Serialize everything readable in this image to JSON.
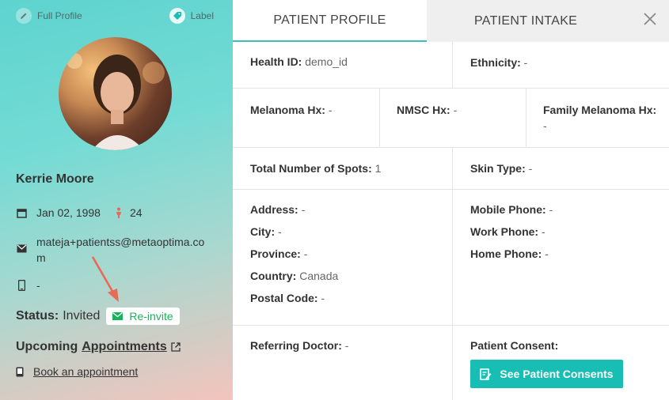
{
  "sidebar": {
    "full_profile_label": "Full Profile",
    "label_label": "Label",
    "name": "Kerrie Moore",
    "dob": "Jan 02, 1998",
    "age": "24",
    "email": "mateja+patientss@metaoptima.com",
    "phone": "-",
    "status_label": "Status:",
    "status_value": "Invited",
    "reinvite_label": "Re-invite",
    "upcoming_label": "Upcoming",
    "appointments_link": "Appointments",
    "book_label": "Book an appointment"
  },
  "tabs": [
    "PATIENT PROFILE",
    "PATIENT INTAKE"
  ],
  "profile": {
    "health_id": {
      "label": "Health ID:",
      "value": "demo_id"
    },
    "ethnicity": {
      "label": "Ethnicity:",
      "value": "-"
    },
    "melanoma_hx": {
      "label": "Melanoma Hx:",
      "value": "-"
    },
    "nmsc_hx": {
      "label": "NMSC Hx:",
      "value": "-"
    },
    "family_melanoma_hx": {
      "label": "Family Melanoma Hx:",
      "value": "-"
    },
    "total_spots": {
      "label": "Total Number of Spots:",
      "value": "1"
    },
    "skin_type": {
      "label": "Skin Type:",
      "value": "-"
    },
    "address": {
      "label": "Address:",
      "value": "-"
    },
    "city": {
      "label": "City:",
      "value": "-"
    },
    "province": {
      "label": "Province:",
      "value": "-"
    },
    "country": {
      "label": "Country:",
      "value": "Canada"
    },
    "postal_code": {
      "label": "Postal Code:",
      "value": "-"
    },
    "mobile_phone": {
      "label": "Mobile Phone:",
      "value": "-"
    },
    "work_phone": {
      "label": "Work Phone:",
      "value": "-"
    },
    "home_phone": {
      "label": "Home Phone:",
      "value": "-"
    },
    "referring_doctor": {
      "label": "Referring Doctor:",
      "value": "-"
    },
    "patient_consent": {
      "label": "Patient Consent:"
    },
    "see_consents_label": "See Patient Consents"
  },
  "colors": {
    "accent": "#18bdb4",
    "reinvite": "#17b35a",
    "arrow": "#e76a55"
  }
}
